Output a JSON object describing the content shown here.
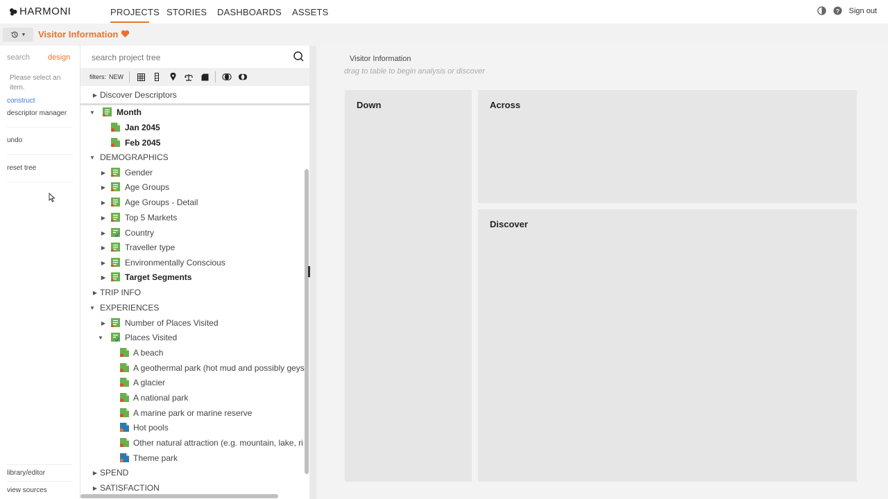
{
  "app": {
    "brand": "HARMONI",
    "accent": "#e8742c"
  },
  "nav": {
    "tabs": [
      {
        "label": "PROJECTS",
        "active": true
      },
      {
        "label": "STORIES"
      },
      {
        "label": "DASHBOARDS"
      },
      {
        "label": "ASSETS"
      }
    ],
    "sign_out": "Sign out"
  },
  "subbar": {
    "project_title": "Visitor Information"
  },
  "left_rail": {
    "tabs": {
      "search": "search",
      "design": "design"
    },
    "hint": "Please select an item.",
    "items": {
      "construct": "construct",
      "descriptor_manager": "descriptor manager",
      "undo": "undo",
      "reset_tree": "reset tree",
      "library_editor": "library/editor",
      "view_sources": "view sources"
    }
  },
  "tree": {
    "search_placeholder": "search project tree",
    "filters_label": "filters:",
    "filters_new": "NEW",
    "rows": [
      {
        "label": "Discover Descriptors"
      },
      {
        "label": "Month"
      },
      {
        "label": "Jan 2045"
      },
      {
        "label": "Feb 2045"
      },
      {
        "label": "DEMOGRAPHICS"
      },
      {
        "label": "Gender"
      },
      {
        "label": "Age Groups"
      },
      {
        "label": "Age Groups - Detail"
      },
      {
        "label": "Top 5 Markets"
      },
      {
        "label": "Country"
      },
      {
        "label": "Traveller type"
      },
      {
        "label": "Environmentally Conscious"
      },
      {
        "label": "Target Segments"
      },
      {
        "label": "TRIP INFO"
      },
      {
        "label": "EXPERIENCES"
      },
      {
        "label": "Number of Places Visited"
      },
      {
        "label": "Places Visited"
      },
      {
        "label": "A beach"
      },
      {
        "label": "A geothermal park (hot mud and possibly geys"
      },
      {
        "label": "A glacier"
      },
      {
        "label": "A national park"
      },
      {
        "label": "A marine park or marine reserve"
      },
      {
        "label": "Hot pools"
      },
      {
        "label": "Other natural attraction (e.g. mountain, lake, ri"
      },
      {
        "label": "Theme park"
      },
      {
        "label": "SPEND"
      },
      {
        "label": "SATISFACTION"
      }
    ]
  },
  "canvas": {
    "title": "Visitor Information",
    "hint": "drag to table to begin analysis or discover",
    "boxes": {
      "down": "Down",
      "across": "Across",
      "discover": "Discover"
    }
  }
}
